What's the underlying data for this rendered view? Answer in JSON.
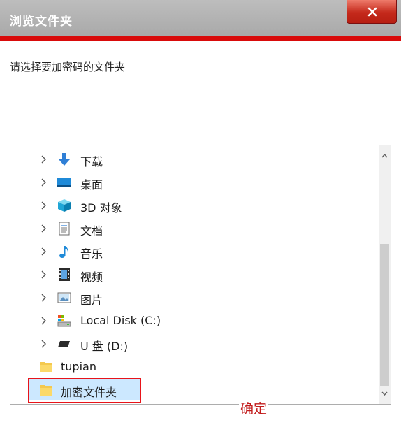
{
  "window": {
    "title": "浏览文件夹",
    "close_label": "x"
  },
  "prompt": "请选择要加密码的文件夹",
  "tree": {
    "items": [
      {
        "label": "下载",
        "icon": "download-arrow-icon",
        "expandable": true
      },
      {
        "label": "桌面",
        "icon": "desktop-icon",
        "expandable": true
      },
      {
        "label": "3D 对象",
        "icon": "3d-objects-icon",
        "expandable": true
      },
      {
        "label": "文档",
        "icon": "document-icon",
        "expandable": true
      },
      {
        "label": "音乐",
        "icon": "music-note-icon",
        "expandable": true
      },
      {
        "label": "视频",
        "icon": "video-film-icon",
        "expandable": true
      },
      {
        "label": "图片",
        "icon": "picture-icon",
        "expandable": true
      },
      {
        "label": "Local Disk (C:)",
        "icon": "local-disk-icon",
        "expandable": true
      },
      {
        "label": "U 盘 (D:)",
        "icon": "usb-drive-icon",
        "expandable": true
      },
      {
        "label": "tupian",
        "icon": "folder-icon",
        "expandable": false
      },
      {
        "label": "加密文件夹",
        "icon": "folder-icon",
        "expandable": false,
        "selected": true
      }
    ]
  },
  "ok_label": "确定",
  "colors": {
    "accent_red": "#d90b0b",
    "selection": "#cce8ff",
    "ok_text": "#c21b1b"
  }
}
